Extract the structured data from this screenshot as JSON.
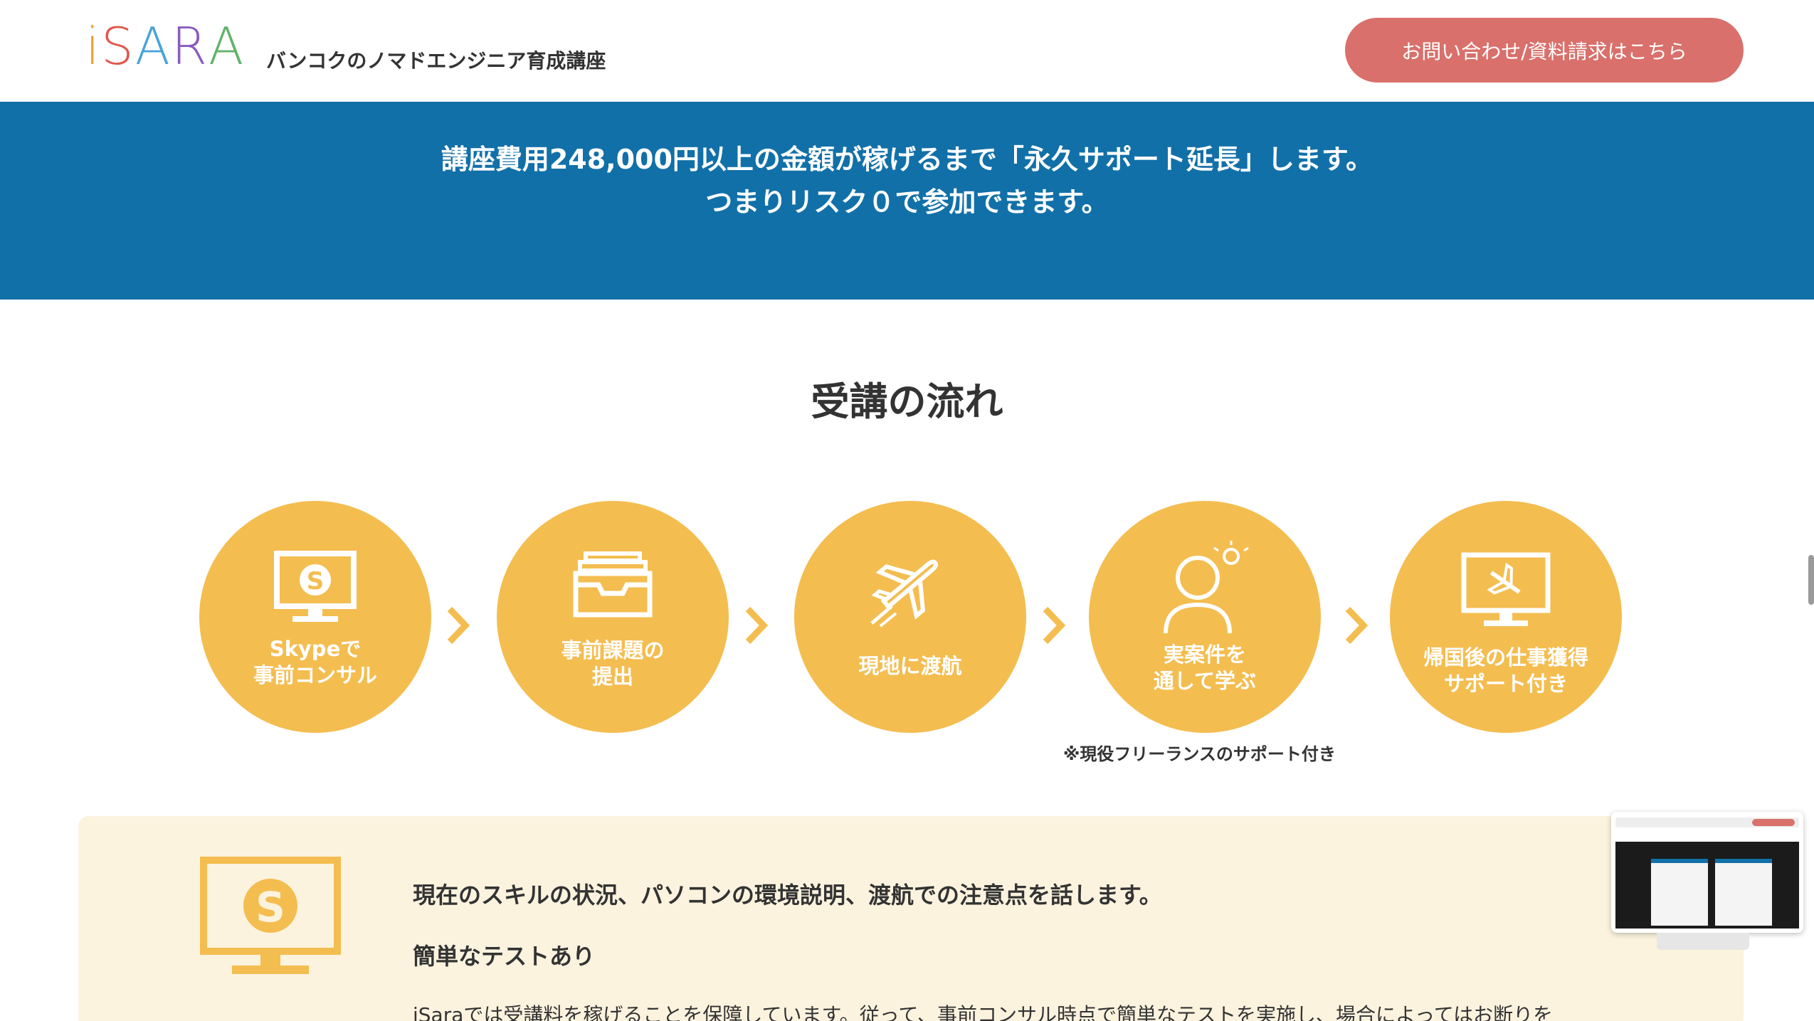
{
  "header": {
    "logo_text": "iSARA",
    "logo_colors": [
      "#f0a23a",
      "#e0574e",
      "#4aa3d8",
      "#8a5bbf",
      "#62b36a"
    ],
    "tagline": "バンコクのノマドエンジニア育成講座",
    "cta_label": "お問い合わせ/資料請求はこちら",
    "cta_color": "#d9706b"
  },
  "banner": {
    "line1": "講座費用248,000円以上の金額が稼げるまで「永久サポート延長」します。",
    "line2": "つまりリスク０で参加できます。",
    "background": "#1270a8"
  },
  "flow": {
    "title": "受講の流れ",
    "circle_color": "#f4bd50",
    "steps": [
      {
        "icon": "skype-monitor-icon",
        "line1": "Skypeで",
        "line2": "事前コンサル"
      },
      {
        "icon": "inbox-tray-icon",
        "line1": "事前課題の",
        "line2": "提出"
      },
      {
        "icon": "airplane-icon",
        "line1": "現地に渡航",
        "line2": ""
      },
      {
        "icon": "person-idea-icon",
        "line1": "実案件を",
        "line2": "通して学ぶ"
      },
      {
        "icon": "monitor-airplane-icon",
        "line1": "帰国後の仕事獲得",
        "line2": "サポート付き"
      }
    ],
    "note": "※現役フリーランスのサポート付き"
  },
  "detail": {
    "icon": "skype-monitor-icon",
    "line1": "現在のスキルの状況、パソコンの環境説明、渡航での注意点を話します。",
    "line2": "簡単なテストあり",
    "line3": "iSaraでは受講料を稼げることを保障しています。従って、事前コンサル時点で簡単なテストを実施し、場合によってはお断りを",
    "background": "#fcf3df"
  }
}
